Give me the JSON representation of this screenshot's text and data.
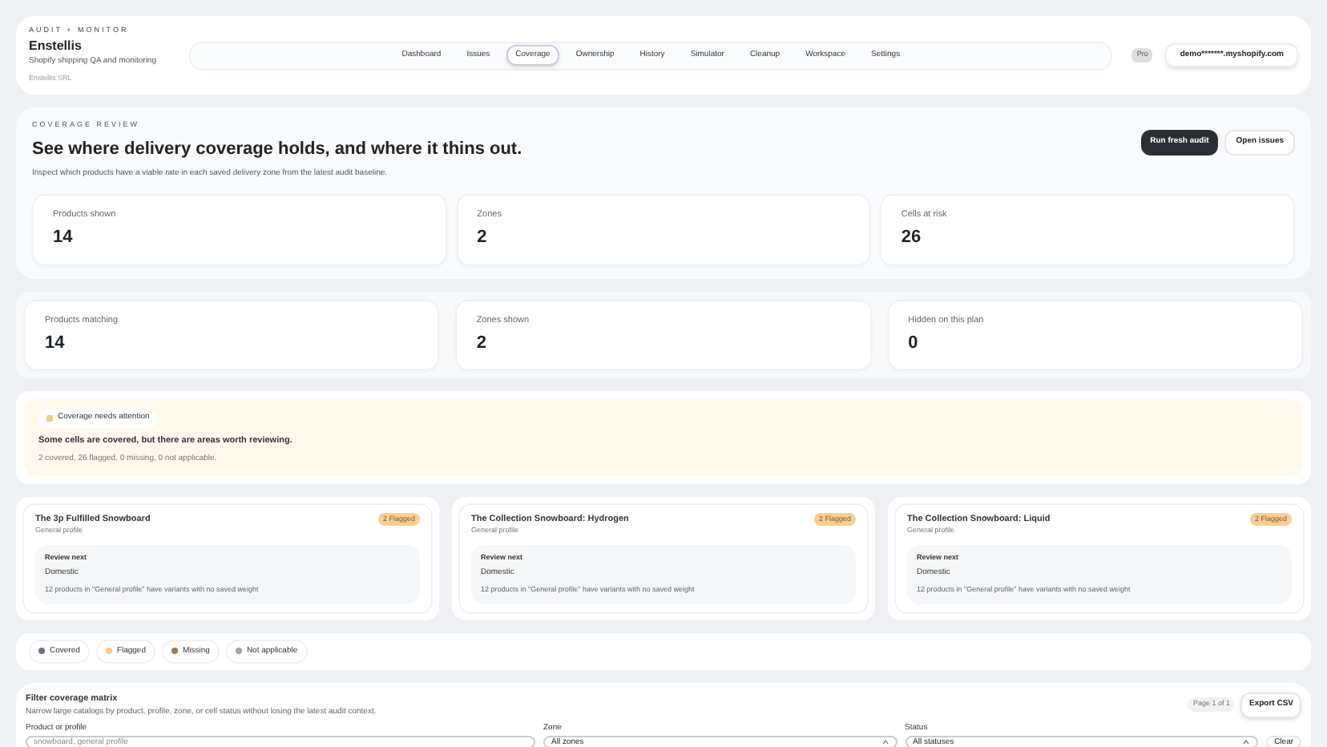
{
  "header": {
    "eyebrow": "AUDIT + MONITOR",
    "app_name": "Enstellis",
    "tagline": "Shopify shipping QA and monitoring",
    "company": "Enstellis SRL",
    "nav": [
      {
        "label": "Dashboard",
        "selected": false
      },
      {
        "label": "Issues",
        "selected": false
      },
      {
        "label": "Coverage",
        "selected": true
      },
      {
        "label": "Ownership",
        "selected": false
      },
      {
        "label": "History",
        "selected": false
      },
      {
        "label": "Simulator",
        "selected": false
      },
      {
        "label": "Cleanup",
        "selected": false
      },
      {
        "label": "Workspace",
        "selected": false
      },
      {
        "label": "Settings",
        "selected": false
      }
    ],
    "plan_badge": "Pro",
    "store": "demo*******.myshopify.com"
  },
  "review": {
    "eyebrow": "COVERAGE REVIEW",
    "title": "See where delivery coverage holds, and where it thins out.",
    "description": "Inspect which products have a viable rate in each saved delivery zone from the latest audit baseline.",
    "buttons": [
      {
        "label": "Run fresh audit",
        "kind": "primary"
      },
      {
        "label": "Open issues",
        "kind": "secondary"
      }
    ],
    "stats": [
      {
        "label": "Products shown",
        "value": "14"
      },
      {
        "label": "Zones",
        "value": "2"
      },
      {
        "label": "Cells at risk",
        "value": "26"
      }
    ]
  },
  "summary_stats": [
    {
      "label": "Products matching",
      "value": "14"
    },
    {
      "label": "Zones shown",
      "value": "2"
    },
    {
      "label": "Hidden on this plan",
      "value": "0"
    }
  ],
  "attention": {
    "badge": "Coverage needs attention",
    "color": "#f7c97e",
    "headline": "Some cells are covered, but there are areas worth reviewing.",
    "detail": "2 covered, 26 flagged, 0 missing, 0 not applicable."
  },
  "products": [
    {
      "name": "The 3p Fulfilled Snowboard",
      "profile": "General profile",
      "badge": "2 Flagged",
      "review_label": "Review next",
      "zone": "Domestic",
      "message": "12 products in \"General profile\" have variants with no saved weight"
    },
    {
      "name": "The Collection Snowboard: Hydrogen",
      "profile": "General profile",
      "badge": "2 Flagged",
      "review_label": "Review next",
      "zone": "Domestic",
      "message": "12 products in \"General profile\" have variants with no saved weight"
    },
    {
      "name": "The Collection Snowboard: Liquid",
      "profile": "General profile",
      "badge": "2 Flagged",
      "review_label": "Review next",
      "zone": "Domestic",
      "message": "12 products in \"General profile\" have variants with no saved weight"
    }
  ],
  "legend": [
    {
      "label": "Covered",
      "color": "#6b7280"
    },
    {
      "label": "Flagged",
      "color": "#f7c97e"
    },
    {
      "label": "Missing",
      "color": "#a0784a"
    },
    {
      "label": "Not applicable",
      "color": "#a1a5ad"
    }
  ],
  "filter": {
    "title": "Filter coverage matrix",
    "description": "Narrow large catalogs by product, profile, zone, or cell status without losing the latest audit context.",
    "page": "Page 1 of 1",
    "export": "Export CSV",
    "fields": [
      {
        "label": "Product or profile",
        "kind": "text",
        "placeholder": "snowboard, general profile"
      },
      {
        "label": "Zone",
        "kind": "select",
        "value": "All zones"
      },
      {
        "label": "Status",
        "kind": "select",
        "value": "All statuses"
      }
    ],
    "clear": "Clear"
  }
}
